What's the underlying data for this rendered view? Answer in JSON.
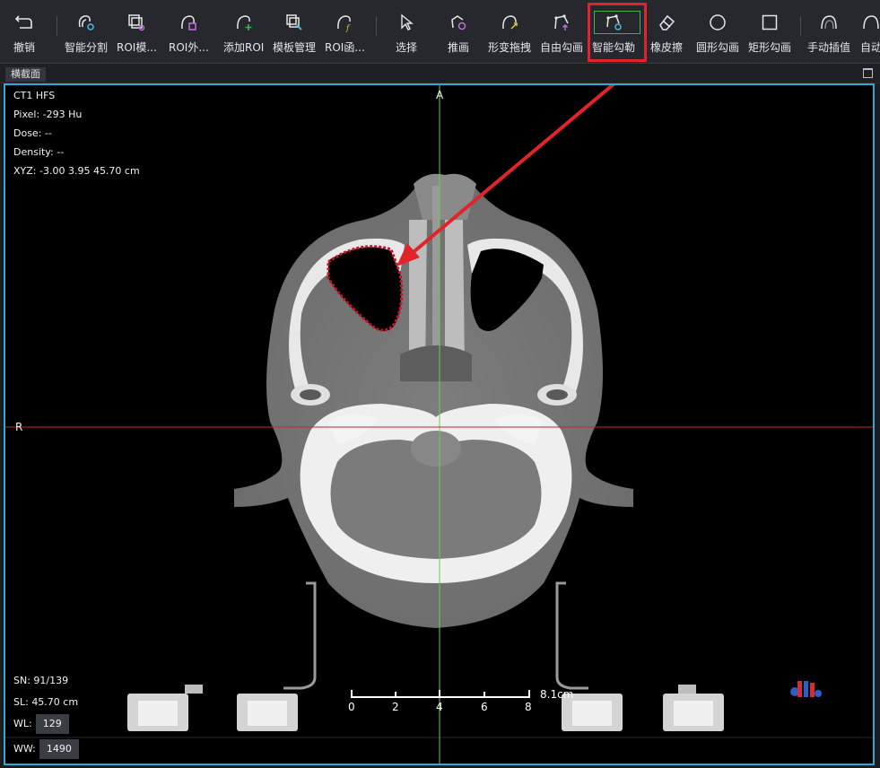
{
  "toolbar": {
    "tools": [
      {
        "name": "undo-button",
        "icon": "undo-icon",
        "label": "撤销"
      },
      {
        "name": "smart-segment-button",
        "icon": "smart-segment-icon",
        "label": "智能分割"
      },
      {
        "name": "roi-template-button",
        "icon": "roi-template-icon",
        "label": "ROI模..."
      },
      {
        "name": "roi-expand-button",
        "icon": "roi-expand-icon",
        "label": "ROI外..."
      },
      {
        "name": "add-roi-button",
        "icon": "add-roi-icon",
        "label": "添加ROI"
      },
      {
        "name": "template-manage-button",
        "icon": "template-manage-icon",
        "label": "模板管理"
      },
      {
        "name": "roi-function-button",
        "icon": "roi-function-icon",
        "label": "ROI函..."
      },
      {
        "name": "select-button",
        "icon": "cursor-icon",
        "label": "选择"
      },
      {
        "name": "push-draw-button",
        "icon": "push-draw-icon",
        "label": "推画"
      },
      {
        "name": "deform-drag-button",
        "icon": "deform-drag-icon",
        "label": "形变拖拽"
      },
      {
        "name": "free-outline-button",
        "icon": "free-outline-icon",
        "label": "自由勾画"
      },
      {
        "name": "smart-outline-button",
        "icon": "smart-outline-icon",
        "label": "智能勾勒"
      },
      {
        "name": "eraser-button",
        "icon": "eraser-icon",
        "label": "橡皮擦"
      },
      {
        "name": "circle-outline-button",
        "icon": "circle-icon",
        "label": "圆形勾画"
      },
      {
        "name": "rect-outline-button",
        "icon": "square-icon",
        "label": "矩形勾画"
      },
      {
        "name": "manual-interp-button",
        "icon": "manual-interp-icon",
        "label": "手动插值"
      },
      {
        "name": "auto-button",
        "icon": "auto-icon",
        "label": "自动"
      }
    ]
  },
  "panel": {
    "title": "横截面"
  },
  "overlay": {
    "series": "CT1 HFS",
    "pixel": "Pixel:  -293 Hu",
    "dose": "Dose:  --",
    "density": "Density:  --",
    "xyz": "XYZ: -3.00 3.95 45.70 cm",
    "label_a": "A",
    "label_r": "R",
    "sn": "SN: 91/139",
    "sl": "SL: 45.70 cm",
    "wl_label": "WL:",
    "wl_value": "129",
    "ww_label": "WW:",
    "ww_value": "1490",
    "scale_ticks": [
      "0",
      "2",
      "4",
      "6",
      "8"
    ],
    "scale_unit": "8.1cm"
  },
  "colors": {
    "accent": "#2ea9d6",
    "crosshair_vertical": "#6fcf4a",
    "crosshair_horizontal": "#c62828",
    "highlight": "#e0242a",
    "contour": "#c8142a"
  }
}
